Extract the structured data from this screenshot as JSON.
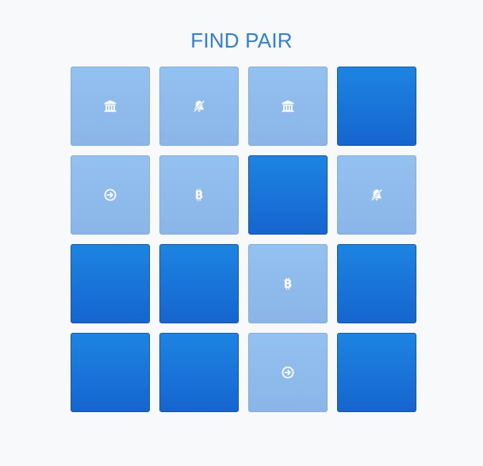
{
  "title": "FIND PAIR",
  "colors": {
    "title": "#2f7fdc",
    "hidden_card": "#1a74da",
    "revealed_card": "#8fbaec",
    "icon": "#ffffff"
  },
  "cards": [
    {
      "state": "revealed",
      "icon": "bank-icon"
    },
    {
      "state": "revealed",
      "icon": "bell-slash-icon"
    },
    {
      "state": "revealed",
      "icon": "bank-icon"
    },
    {
      "state": "hidden",
      "icon": ""
    },
    {
      "state": "revealed",
      "icon": "arrow-circle-right-icon"
    },
    {
      "state": "revealed",
      "icon": "bitcoin-icon"
    },
    {
      "state": "hidden",
      "icon": ""
    },
    {
      "state": "revealed",
      "icon": "bell-slash-icon"
    },
    {
      "state": "hidden",
      "icon": ""
    },
    {
      "state": "hidden",
      "icon": ""
    },
    {
      "state": "revealed",
      "icon": "bitcoin-icon"
    },
    {
      "state": "hidden",
      "icon": ""
    },
    {
      "state": "hidden",
      "icon": ""
    },
    {
      "state": "hidden",
      "icon": ""
    },
    {
      "state": "revealed",
      "icon": "arrow-circle-right-icon"
    },
    {
      "state": "hidden",
      "icon": ""
    }
  ]
}
